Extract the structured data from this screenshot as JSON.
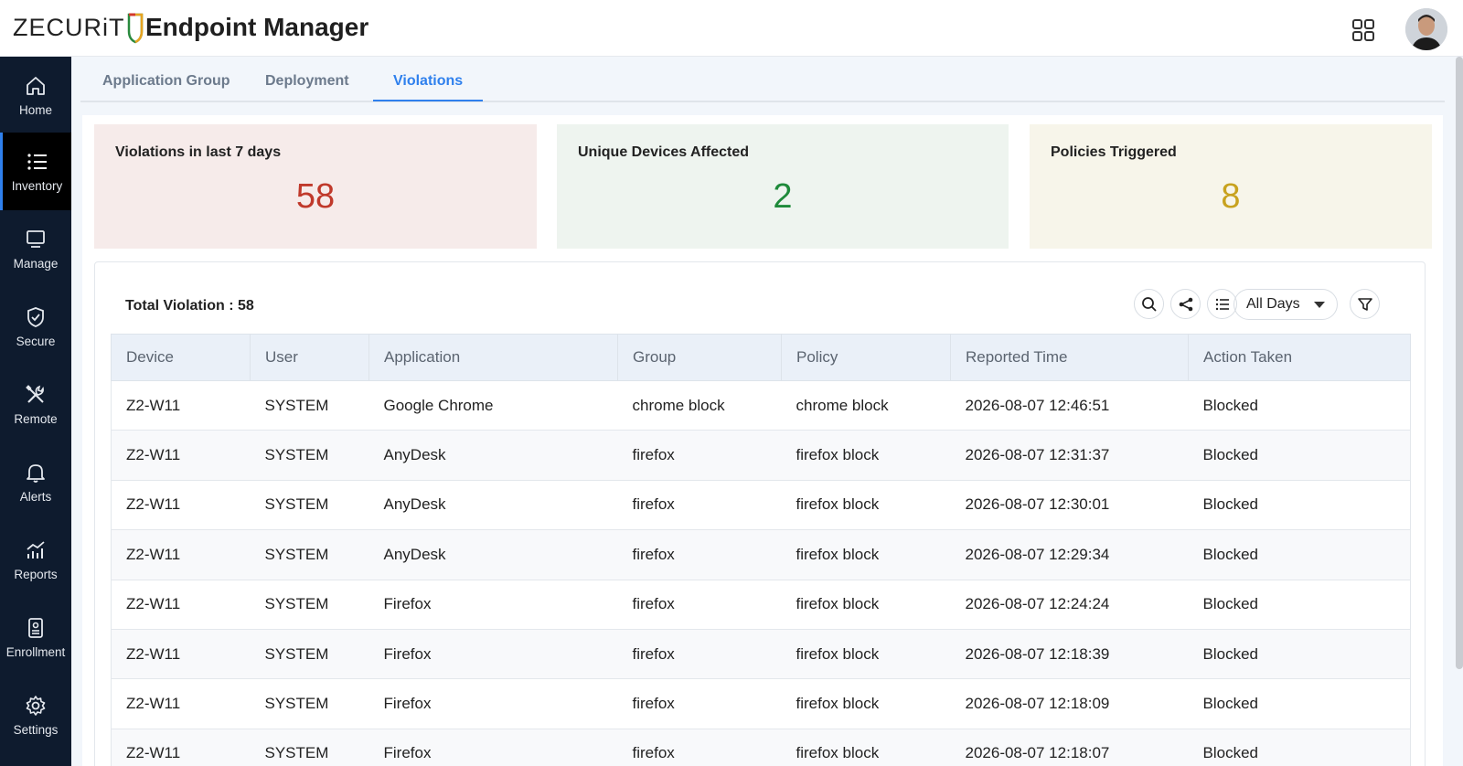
{
  "header": {
    "logo_text": "ZECURiT",
    "app_title": "Endpoint Manager"
  },
  "sidebar": {
    "items": [
      {
        "label": "Home",
        "icon": "home-icon"
      },
      {
        "label": "Inventory",
        "icon": "list-icon",
        "active": true
      },
      {
        "label": "Manage",
        "icon": "monitor-icon"
      },
      {
        "label": "Secure",
        "icon": "shield-check-icon"
      },
      {
        "label": "Remote",
        "icon": "tools-icon"
      },
      {
        "label": "Alerts",
        "icon": "bell-icon"
      },
      {
        "label": "Reports",
        "icon": "chart-icon"
      },
      {
        "label": "Enrollment",
        "icon": "badge-icon"
      },
      {
        "label": "Settings",
        "icon": "gear-icon"
      }
    ]
  },
  "tabs": [
    {
      "label": "Application Group"
    },
    {
      "label": "Deployment"
    },
    {
      "label": "Violations",
      "active": true
    }
  ],
  "stats": [
    {
      "title": "Violations in last 7 days",
      "value": "58",
      "color": "#c0392b",
      "bg": "#f6ebea"
    },
    {
      "title": "Unique Devices Affected",
      "value": "2",
      "color": "#1e8a3a",
      "bg": "#eef4ef"
    },
    {
      "title": "Policies Triggered",
      "value": "8",
      "color": "#c8a21f",
      "bg": "#f7f5ea"
    }
  ],
  "table": {
    "total_label": "Total Violation : 58",
    "filter_value": "All Days",
    "columns": [
      "Device",
      "User",
      "Application",
      "Group",
      "Policy",
      "Reported Time",
      "Action Taken"
    ],
    "rows": [
      [
        "Z2-W11",
        "SYSTEM",
        "Google Chrome",
        "chrome block",
        "chrome block",
        "2026-08-07 12:46:51",
        "Blocked"
      ],
      [
        "Z2-W11",
        "SYSTEM",
        "AnyDesk",
        "firefox",
        "firefox block",
        "2026-08-07 12:31:37",
        "Blocked"
      ],
      [
        "Z2-W11",
        "SYSTEM",
        "AnyDesk",
        "firefox",
        "firefox block",
        "2026-08-07 12:30:01",
        "Blocked"
      ],
      [
        "Z2-W11",
        "SYSTEM",
        "AnyDesk",
        "firefox",
        "firefox block",
        "2026-08-07 12:29:34",
        "Blocked"
      ],
      [
        "Z2-W11",
        "SYSTEM",
        "Firefox",
        "firefox",
        "firefox block",
        "2026-08-07 12:24:24",
        "Blocked"
      ],
      [
        "Z2-W11",
        "SYSTEM",
        "Firefox",
        "firefox",
        "firefox block",
        "2026-08-07 12:18:39",
        "Blocked"
      ],
      [
        "Z2-W11",
        "SYSTEM",
        "Firefox",
        "firefox",
        "firefox block",
        "2026-08-07 12:18:09",
        "Blocked"
      ],
      [
        "Z2-W11",
        "SYSTEM",
        "Firefox",
        "firefox",
        "firefox block",
        "2026-08-07 12:18:07",
        "Blocked"
      ]
    ]
  },
  "colors": {
    "accent": "#2f80ed",
    "sidebar_bg": "#0e1b2e"
  }
}
